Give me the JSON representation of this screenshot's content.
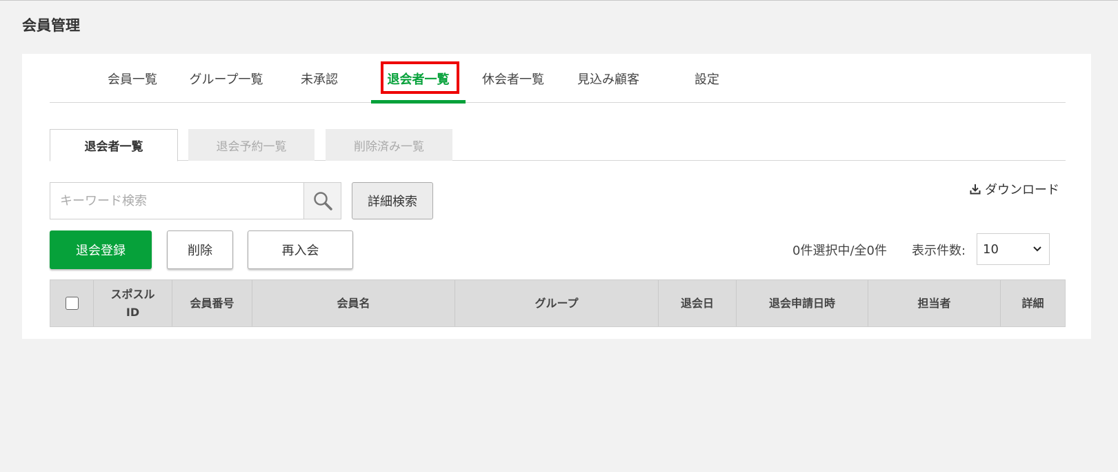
{
  "page": {
    "title": "会員管理"
  },
  "main_tabs": [
    {
      "label": "会員一覧"
    },
    {
      "label": "グループ一覧"
    },
    {
      "label": "未承認"
    },
    {
      "label": "退会者一覧",
      "active": true
    },
    {
      "label": "休会者一覧"
    },
    {
      "label": "見込み顧客"
    },
    {
      "label": "設定"
    }
  ],
  "sub_tabs": [
    {
      "label": "退会者一覧",
      "active": true
    },
    {
      "label": "退会予約一覧"
    },
    {
      "label": "削除済み一覧"
    }
  ],
  "search": {
    "placeholder": "キーワード検索",
    "value": "",
    "advanced_label": "詳細検索"
  },
  "download": {
    "label": "ダウンロード",
    "icon": "download-icon"
  },
  "actions": {
    "register_label": "退会登録",
    "delete_label": "削除",
    "rejoin_label": "再入会"
  },
  "selection": {
    "text": "0件選択中/全0件"
  },
  "page_size": {
    "label": "表示件数:",
    "value": "10"
  },
  "table": {
    "headers": [
      "スポスル\nID",
      "会員番号",
      "会員名",
      "グループ",
      "退会日",
      "退会申請日時",
      "担当者",
      "詳細"
    ]
  },
  "colors": {
    "accent": "#06a13a",
    "highlight": "#ee0000"
  }
}
